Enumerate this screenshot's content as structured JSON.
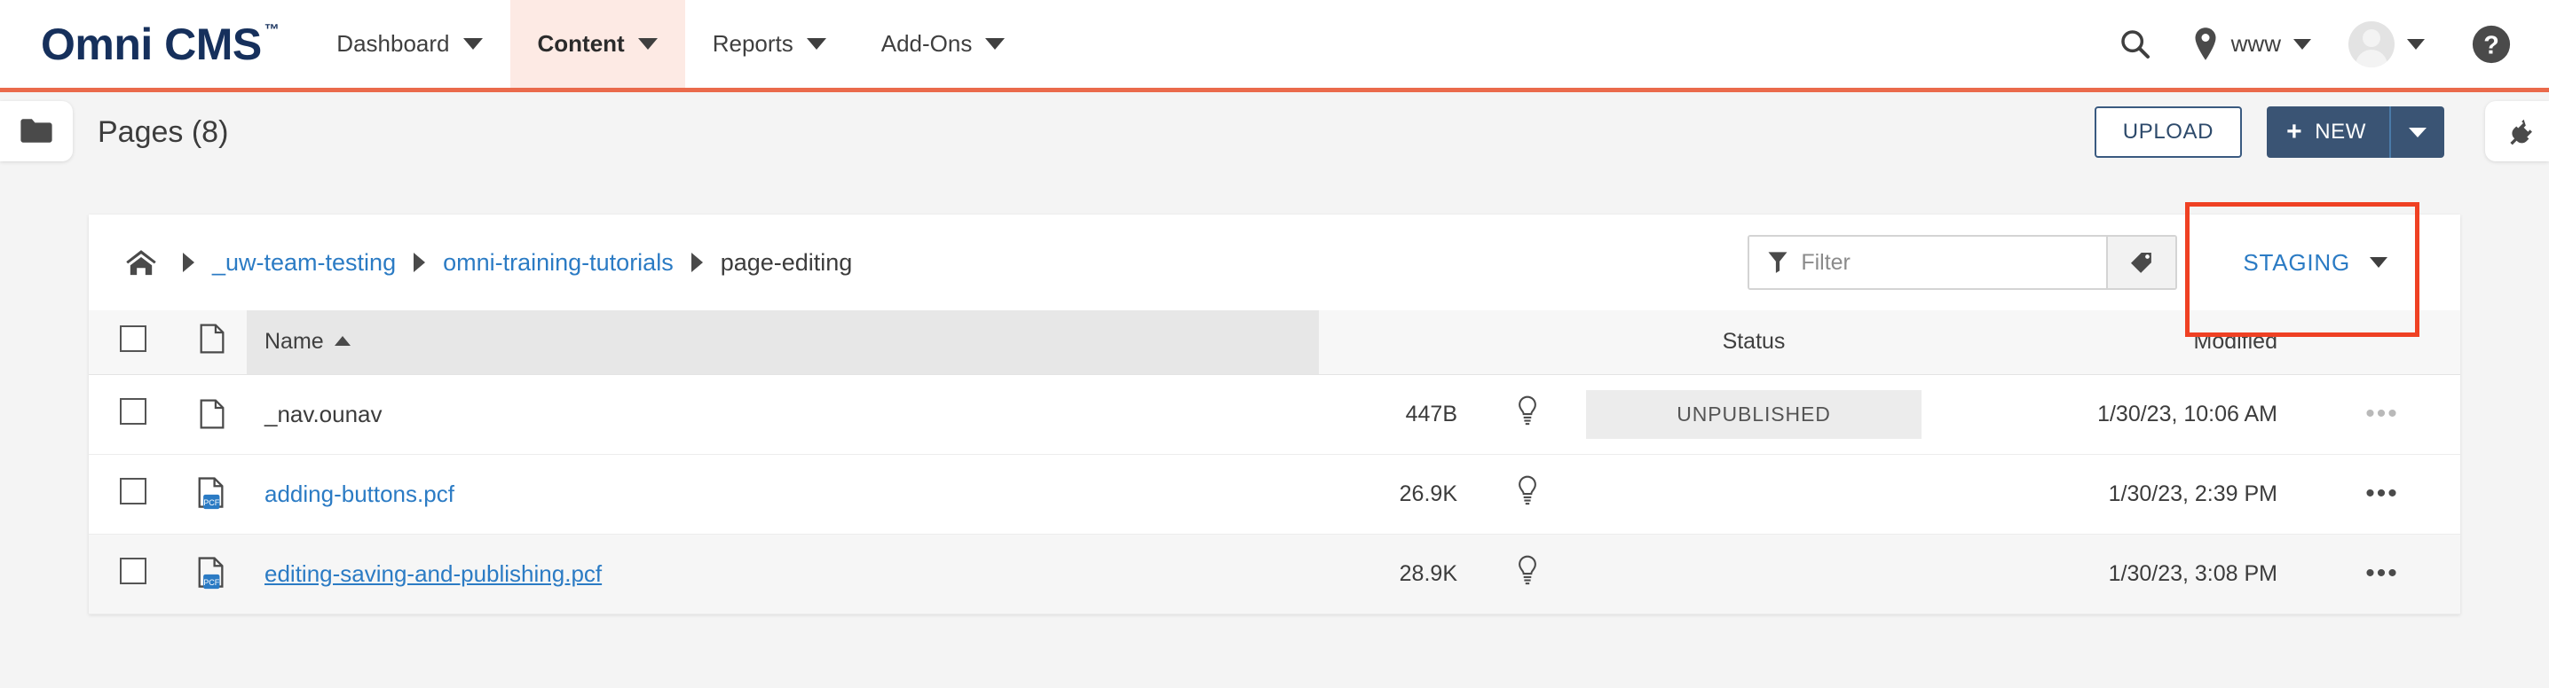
{
  "brand": {
    "name": "Omni CMS",
    "tm": "™"
  },
  "topnav": {
    "items": [
      {
        "label": "Dashboard",
        "active": false
      },
      {
        "label": "Content",
        "active": true
      },
      {
        "label": "Reports",
        "active": false
      },
      {
        "label": "Add-Ons",
        "active": false
      }
    ],
    "search_icon": "search-icon",
    "site_icon": "location-pin-icon",
    "site_label": "www",
    "avatar_icon": "user-avatar",
    "help_icon": "help-question-icon"
  },
  "pagebar": {
    "folder_icon": "folder-icon",
    "title": "Pages (8)",
    "upload_label": "UPLOAD",
    "new_label": "NEW",
    "new_plus": "+",
    "gadget_icon": "plug-icon"
  },
  "breadcrumb": {
    "home_icon": "home-icon",
    "separator": "▶",
    "items": [
      {
        "label": "_uw-team-testing",
        "link": true
      },
      {
        "label": "omni-training-tutorials",
        "link": true
      },
      {
        "label": "page-editing",
        "link": false
      }
    ]
  },
  "filter": {
    "icon": "funnel-icon",
    "placeholder": "Filter",
    "value": "",
    "tag_icon": "tag-icon"
  },
  "staging": {
    "label": "STAGING",
    "chevron": "chevron-down-icon",
    "highlight_color": "#ef4123"
  },
  "table": {
    "columns": [
      {
        "key": "checkbox",
        "label": ""
      },
      {
        "key": "icon",
        "label": ""
      },
      {
        "key": "name",
        "label": "Name",
        "sorted": true,
        "sort_dir": "asc"
      },
      {
        "key": "size",
        "label": ""
      },
      {
        "key": "bulb",
        "label": ""
      },
      {
        "key": "status",
        "label": "Status"
      },
      {
        "key": "modified",
        "label": "Modified"
      },
      {
        "key": "menu",
        "label": ""
      }
    ],
    "rows": [
      {
        "checked": false,
        "file_icon": "file-blank-icon",
        "file_badge": "",
        "name": "_nav.ounav",
        "is_link": false,
        "underlined": false,
        "size": "447B",
        "bulb_icon": "lightbulb-icon",
        "status": "UNPUBLISHED",
        "modified": "1/30/23, 10:06 AM",
        "menu_icon": "•••",
        "menu_muted": true,
        "hover": false
      },
      {
        "checked": false,
        "file_icon": "file-pcf-icon",
        "file_badge": "PCF",
        "name": "adding-buttons.pcf",
        "is_link": true,
        "underlined": false,
        "size": "26.9K",
        "bulb_icon": "lightbulb-icon",
        "status": "",
        "modified": "1/30/23, 2:39 PM",
        "menu_icon": "•••",
        "menu_muted": false,
        "hover": false
      },
      {
        "checked": false,
        "file_icon": "file-pcf-icon",
        "file_badge": "PCF",
        "name": "editing-saving-and-publishing.pcf",
        "is_link": true,
        "underlined": true,
        "size": "28.9K",
        "bulb_icon": "lightbulb-icon",
        "status": "",
        "modified": "1/30/23, 3:08 PM",
        "menu_icon": "•••",
        "menu_muted": false,
        "hover": true
      }
    ]
  },
  "colors": {
    "brand_navy": "#16305c",
    "accent_orange": "#ea6a4b",
    "link_blue": "#2b7bc4",
    "button_navy": "#3a5474",
    "highlight_red": "#ef4123",
    "pcf_badge_blue": "#2b7bc4"
  }
}
